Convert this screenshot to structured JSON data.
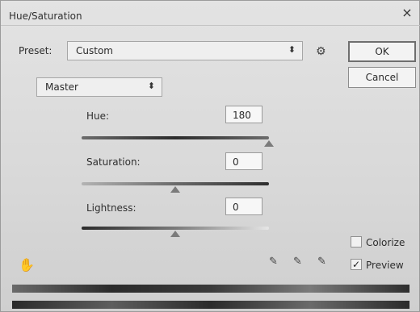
{
  "window": {
    "title": "Hue/Saturation",
    "close_glyph": "×"
  },
  "preset": {
    "label": "Preset:",
    "value": "Custom"
  },
  "channel": {
    "value": "Master"
  },
  "buttons": {
    "ok": "OK",
    "cancel": "Cancel"
  },
  "adjustments": {
    "hue": {
      "label": "Hue:",
      "value": "180",
      "slider_fraction": 1.0
    },
    "saturation": {
      "label": "Saturation:",
      "value": "0",
      "slider_fraction": 0.5
    },
    "lightness": {
      "label": "Lightness:",
      "value": "0",
      "slider_fraction": 0.5
    }
  },
  "options": {
    "colorize": {
      "label": "Colorize",
      "checked": false
    },
    "preview": {
      "label": "Preview",
      "checked": true
    }
  },
  "icons": {
    "preset_options": "gear-icon",
    "targeted_adjustment": "hand-icon",
    "eyedroppers": [
      "eyedropper-icon",
      "eyedropper-plus-icon",
      "eyedropper-minus-icon"
    ]
  }
}
